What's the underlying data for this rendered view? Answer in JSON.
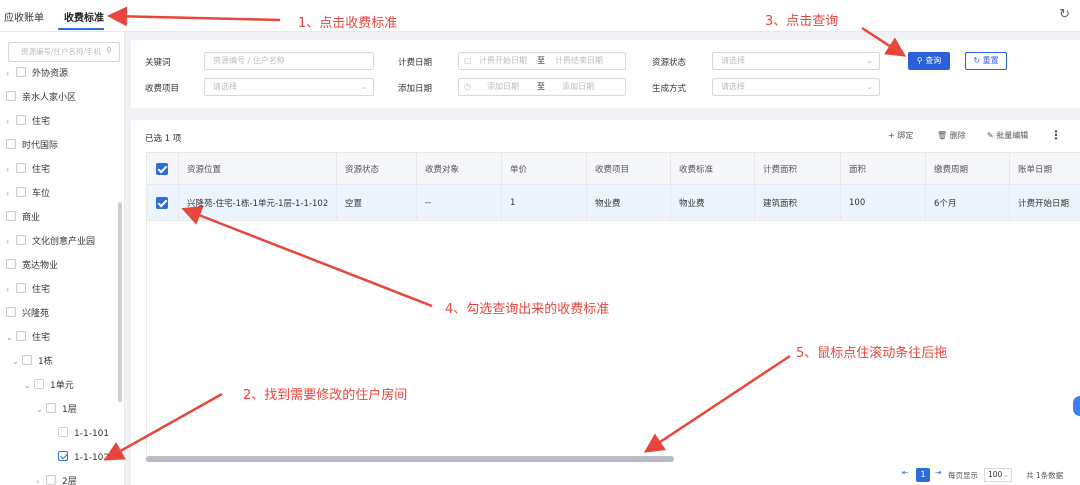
{
  "topbar": {
    "tabs": [
      {
        "label": "应收账单"
      },
      {
        "label": "收费标准"
      }
    ],
    "refresh_icon": "↻"
  },
  "sidebar": {
    "search_placeholder": "资源编号/住户名称/手机",
    "items": [
      {
        "label": "外协资源"
      },
      {
        "label": "亲水人家小区"
      },
      {
        "label": "住宅"
      },
      {
        "label": "时代国际"
      },
      {
        "label": "住宅"
      },
      {
        "label": "车位"
      },
      {
        "label": "商业"
      },
      {
        "label": "文化创意产业园"
      },
      {
        "label": "宽达物业"
      },
      {
        "label": "住宅"
      },
      {
        "label": "兴隆苑"
      },
      {
        "label": "住宅"
      },
      {
        "label": "1栋"
      },
      {
        "label": "1单元"
      },
      {
        "label": "1层"
      },
      {
        "label": "1-1-101"
      },
      {
        "label": "1-1-102"
      },
      {
        "label": "2层"
      }
    ]
  },
  "filters": {
    "keyword_label": "关键词",
    "keyword_placeholder": "资源编号 / 住户名称",
    "billing_date_label": "计费日期",
    "billing_start_placeholder": "计费开始日期",
    "billing_end_placeholder": "计费结束日期",
    "to_label": "至",
    "resource_status_label": "资源状态",
    "select_placeholder": "请选择",
    "fee_item_label": "收费项目",
    "add_date_label": "添加日期",
    "add_date_placeholder": "添加日期",
    "generate_mode_label": "生成方式",
    "query_button": "查询",
    "reset_button": "重置"
  },
  "table": {
    "selected_text": "已选 1 项",
    "toolbar": {
      "bind": "+ 绑定",
      "delete": "删除",
      "batch_edit": "批量编辑"
    },
    "columns": [
      "资源位置",
      "资源状态",
      "收费对象",
      "单价",
      "收费项目",
      "收费标准",
      "计费面积",
      "面积",
      "缴费周期",
      "账单日期"
    ],
    "rows": [
      [
        "兴隆苑-住宅-1栋-1单元-1层-1-1-102",
        "空置",
        "--",
        "1",
        "物业费",
        "物业费",
        "建筑面积",
        "100",
        "6个月",
        "计费开始日期"
      ]
    ]
  },
  "pager": {
    "current_page": "1",
    "per_page_label": "每页显示",
    "page_size": "100",
    "total_text": "共 1条数据"
  },
  "annotations": {
    "a1": "1、点击收费标准",
    "a2": "2、找到需要修改的住户房间",
    "a3": "3、点击查询",
    "a4": "4、勾选查询出来的收费标准",
    "a5": "5、鼠标点住滚动条往后拖"
  },
  "colors": {
    "accent": "#2d6ddc",
    "annotation": "#e8453c"
  }
}
